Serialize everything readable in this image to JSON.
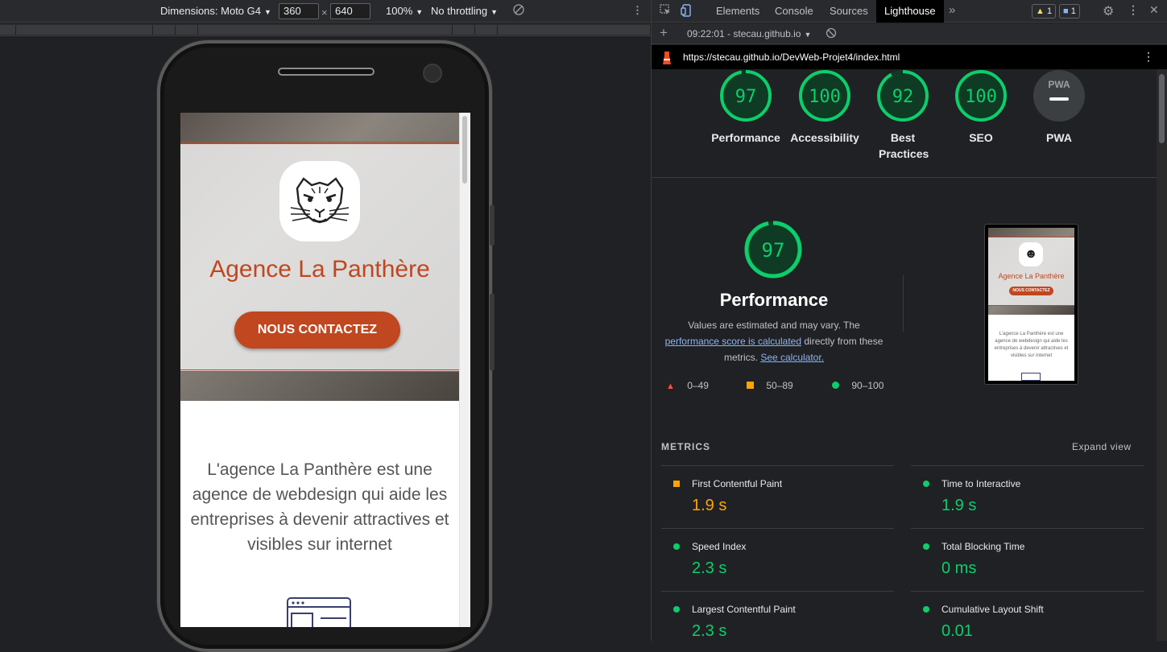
{
  "emulation": {
    "dimensions_label": "Dimensions: Moto G4",
    "width": "360",
    "height": "640",
    "times": "×",
    "zoom": "100%",
    "throttling": "No throttling"
  },
  "site": {
    "title": "Agence La Panthère",
    "cta": "NOUS CONTACTEZ",
    "description": "L'agence La Panthère est une agence de webdesign qui aide les entreprises à devenir attractives et visibles sur internet",
    "accent": "#c0471f"
  },
  "devtools": {
    "tabs": [
      "Elements",
      "Console",
      "Sources",
      "Lighthouse"
    ],
    "active_tab": "Lighthouse",
    "more": "»",
    "warnings": "1",
    "messages": "1",
    "report_time": "09:22:01 - stecau.github.io",
    "url": "https://stecau.github.io/DevWeb-Projet4/index.html"
  },
  "scores": [
    {
      "label": "Performance",
      "value": "97",
      "fraction": 0.97
    },
    {
      "label": "Accessibility",
      "value": "100",
      "fraction": 1.0
    },
    {
      "label": "Best Practices",
      "value": "92",
      "fraction": 0.92
    },
    {
      "label": "SEO",
      "value": "100",
      "fraction": 1.0
    },
    {
      "label": "PWA",
      "value": "PWA",
      "fraction": 0
    }
  ],
  "performance": {
    "score": "97",
    "fraction": 0.97,
    "title": "Performance",
    "desc_1": "Values are estimated and may vary. The",
    "link_1": "performance score is calculated",
    "desc_2": "directly from these metrics.",
    "link_2": "See calculator.",
    "legend": [
      "0–49",
      "50–89",
      "90–100"
    ]
  },
  "thumbnail": {
    "title": "Agence La Panthère",
    "cta": "NOUS CONTACTEZ",
    "text": "L'agence La Panthère est une agence de webdesign qui aide les entreprises à devenir attractives et visibles sur internet"
  },
  "metrics": {
    "heading": "METRICS",
    "expand": "Expand view",
    "items": [
      {
        "name": "First Contentful Paint",
        "value": "1.9 s",
        "status": "average"
      },
      {
        "name": "Time to Interactive",
        "value": "1.9 s",
        "status": "pass"
      },
      {
        "name": "Speed Index",
        "value": "2.3 s",
        "status": "pass"
      },
      {
        "name": "Total Blocking Time",
        "value": "0 ms",
        "status": "pass"
      },
      {
        "name": "Largest Contentful Paint",
        "value": "2.3 s",
        "status": "pass"
      },
      {
        "name": "Cumulative Layout Shift",
        "value": "0.01",
        "status": "pass"
      }
    ]
  },
  "colors": {
    "pass": "#0cce6b",
    "average": "#ffa400",
    "fail": "#ff4e42",
    "gauge_track": "#0f3a24"
  }
}
